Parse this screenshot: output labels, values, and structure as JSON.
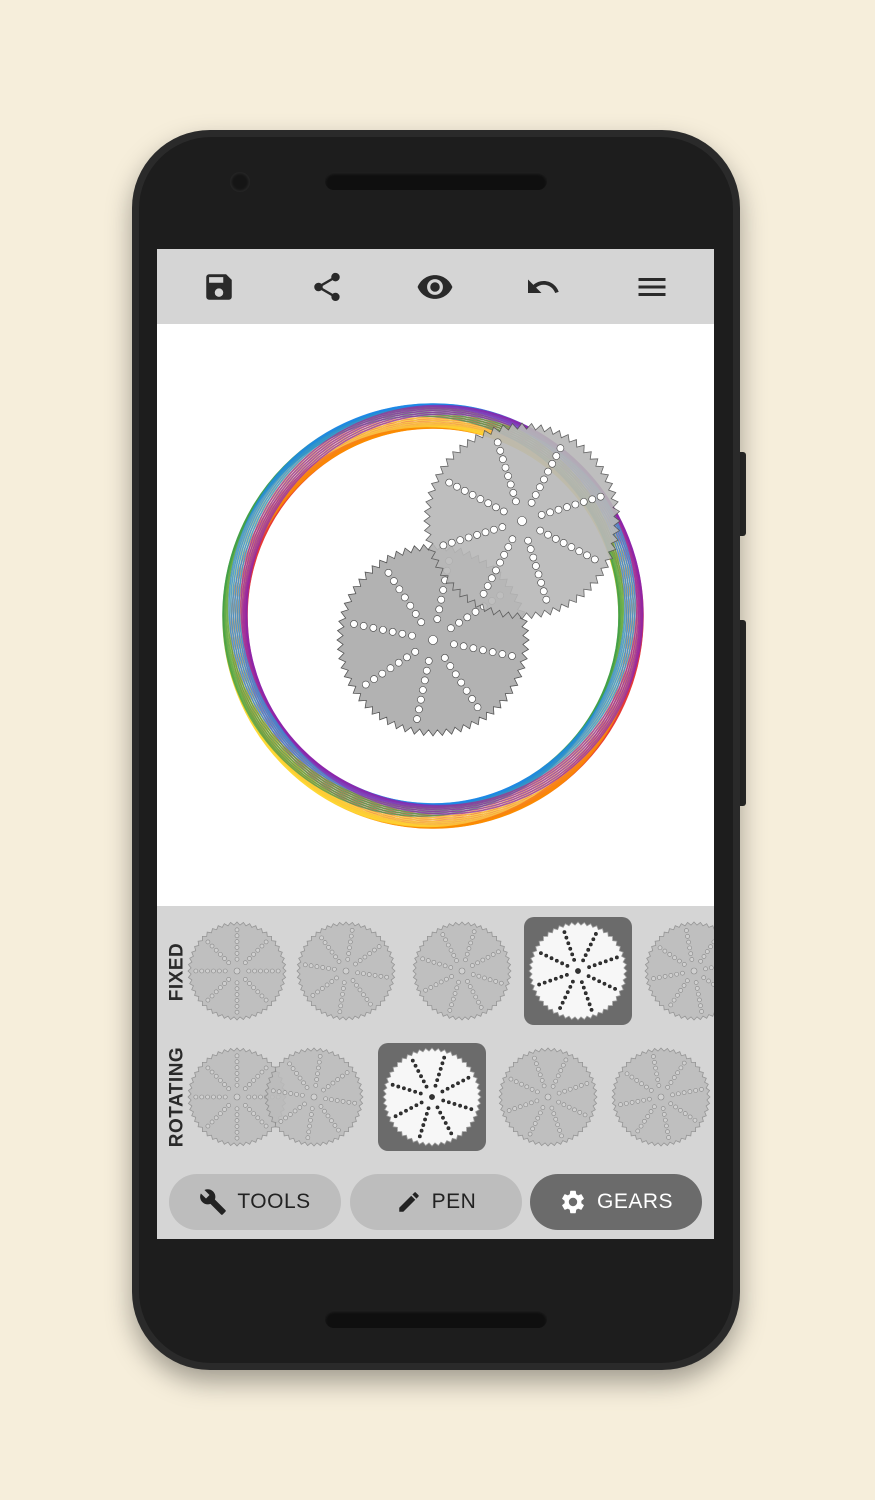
{
  "toolbar": {
    "items": [
      {
        "icon": "save-icon"
      },
      {
        "icon": "share-icon"
      },
      {
        "icon": "eye-icon"
      },
      {
        "icon": "undo-icon"
      },
      {
        "icon": "menu-icon"
      }
    ]
  },
  "gear_panel": {
    "fixed_label": "FIXED",
    "rotating_label": "ROTATING",
    "fixed_selected_index": 3,
    "rotating_selected_index": 2
  },
  "bottom_nav": {
    "tools": {
      "label": "TOOLS",
      "icon": "wrench-icon"
    },
    "pen": {
      "label": "PEN",
      "icon": "pencil-icon"
    },
    "gears": {
      "label": "GEARS",
      "icon": "gear-icon",
      "active": true
    }
  },
  "colors": {
    "background": "#f6eedb",
    "toolbar": "#d5d5d5",
    "selected": "#6b6b6b",
    "button": "#bdbdbd",
    "rainbow": [
      "#e53935",
      "#fb8c00",
      "#fdd835",
      "#43a047",
      "#1e88e5",
      "#8e24aa"
    ]
  }
}
